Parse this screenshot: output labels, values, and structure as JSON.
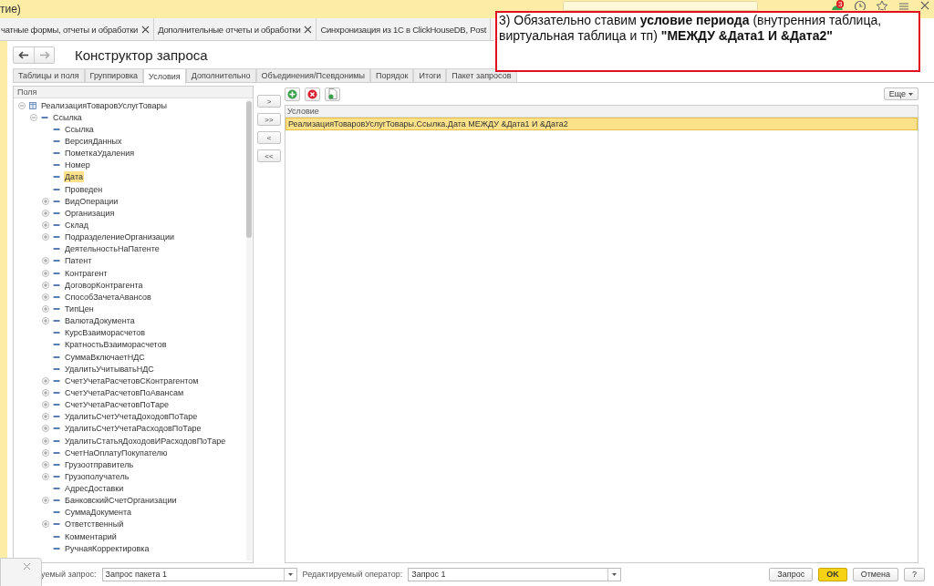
{
  "app_bar": {
    "title": "тие)",
    "badge": "3"
  },
  "window_tabs": [
    {
      "label": "чатные формы, отчеты и обработки",
      "closable": true
    },
    {
      "label": "Дополнительные отчеты и обработки",
      "closable": true
    },
    {
      "label": "Синхронизация из 1С в ClickHouseDB, Post",
      "closable": false
    }
  ],
  "form": {
    "title": "Конструктор запроса",
    "tabs": [
      {
        "label": "Таблицы и поля",
        "selected": false
      },
      {
        "label": "Группировка",
        "selected": false
      },
      {
        "label": "Условия",
        "selected": true
      },
      {
        "label": "Дополнительно",
        "selected": false
      },
      {
        "label": "Объединения/Псевдонимы",
        "selected": false
      },
      {
        "label": "Порядок",
        "selected": false
      },
      {
        "label": "Итоги",
        "selected": false
      },
      {
        "label": "Пакет запросов",
        "selected": false
      }
    ],
    "fields_header": "Поля",
    "tree": [
      {
        "label": "РеализацияТоваровУслугТовары",
        "kind": "table",
        "expanded": true,
        "selected": false,
        "children": [
          {
            "label": "Ссылка",
            "kind": "field",
            "expanded": true,
            "selected": false,
            "children": [
              {
                "label": "Ссылка",
                "kind": "field",
                "expandable": false,
                "selected": false
              },
              {
                "label": "ВерсияДанных",
                "kind": "field",
                "expandable": false,
                "selected": false
              },
              {
                "label": "ПометкаУдаления",
                "kind": "field",
                "expandable": false,
                "selected": false
              },
              {
                "label": "Номер",
                "kind": "field",
                "expandable": false,
                "selected": false
              },
              {
                "label": "Дата",
                "kind": "field",
                "expandable": false,
                "selected": true
              },
              {
                "label": "Проведен",
                "kind": "field",
                "expandable": false,
                "selected": false
              },
              {
                "label": "ВидОперации",
                "kind": "field",
                "expandable": true,
                "selected": false
              },
              {
                "label": "Организация",
                "kind": "field",
                "expandable": true,
                "selected": false
              },
              {
                "label": "Склад",
                "kind": "field",
                "expandable": true,
                "selected": false
              },
              {
                "label": "ПодразделениеОрганизации",
                "kind": "field",
                "expandable": true,
                "selected": false
              },
              {
                "label": "ДеятельностьНаПатенте",
                "kind": "field",
                "expandable": false,
                "selected": false
              },
              {
                "label": "Патент",
                "kind": "field",
                "expandable": true,
                "selected": false
              },
              {
                "label": "Контрагент",
                "kind": "field",
                "expandable": true,
                "selected": false
              },
              {
                "label": "ДоговорКонтрагента",
                "kind": "field",
                "expandable": true,
                "selected": false
              },
              {
                "label": "СпособЗачетаАвансов",
                "kind": "field",
                "expandable": true,
                "selected": false
              },
              {
                "label": "ТипЦен",
                "kind": "field",
                "expandable": true,
                "selected": false
              },
              {
                "label": "ВалютаДокумента",
                "kind": "field",
                "expandable": true,
                "selected": false
              },
              {
                "label": "КурсВзаиморасчетов",
                "kind": "field",
                "expandable": false,
                "selected": false
              },
              {
                "label": "КратностьВзаиморасчетов",
                "kind": "field",
                "expandable": false,
                "selected": false
              },
              {
                "label": "СуммаВключаетНДС",
                "kind": "field",
                "expandable": false,
                "selected": false
              },
              {
                "label": "УдалитьУчитыватьНДС",
                "kind": "field",
                "expandable": false,
                "selected": false
              },
              {
                "label": "СчетУчетаРасчетовСКонтрагентом",
                "kind": "field",
                "expandable": true,
                "selected": false
              },
              {
                "label": "СчетУчетаРасчетовПоАвансам",
                "kind": "field",
                "expandable": true,
                "selected": false
              },
              {
                "label": "СчетУчетаРасчетовПоТаре",
                "kind": "field",
                "expandable": true,
                "selected": false
              },
              {
                "label": "УдалитьСчетУчетаДоходовПоТаре",
                "kind": "field",
                "expandable": true,
                "selected": false
              },
              {
                "label": "УдалитьСчетУчетаРасходовПоТаре",
                "kind": "field",
                "expandable": true,
                "selected": false
              },
              {
                "label": "УдалитьСтатьяДоходовИРасходовПоТаре",
                "kind": "field",
                "expandable": true,
                "selected": false
              },
              {
                "label": "СчетНаОплатуПокупателю",
                "kind": "field",
                "expandable": true,
                "selected": false
              },
              {
                "label": "Грузоотправитель",
                "kind": "field",
                "expandable": true,
                "selected": false
              },
              {
                "label": "Грузополучатель",
                "kind": "field",
                "expandable": true,
                "selected": false
              },
              {
                "label": "АдресДоставки",
                "kind": "field",
                "expandable": false,
                "selected": false
              },
              {
                "label": "БанковскийСчетОрганизации",
                "kind": "field",
                "expandable": true,
                "selected": false
              },
              {
                "label": "СуммаДокумента",
                "kind": "field",
                "expandable": false,
                "selected": false
              },
              {
                "label": "Ответственный",
                "kind": "field",
                "expandable": true,
                "selected": false
              },
              {
                "label": "Комментарий",
                "kind": "field",
                "expandable": false,
                "selected": false
              },
              {
                "label": "РучнаяКорректировка",
                "kind": "field",
                "expandable": false,
                "selected": false
              }
            ]
          }
        ]
      }
    ],
    "move_buttons": [
      ">",
      ">>",
      "<",
      "<<"
    ],
    "more_button": "Еще",
    "conditions": {
      "column": "Условие",
      "rows": [
        {
          "text": "РеализацияТоваровУслугТовары.Ссылка.Дата МЕЖДУ &Дата1 И &Дата2",
          "selected": true
        }
      ]
    },
    "bottom": {
      "query_label": "уемый запрос:",
      "query_value": "Запрос пакета 1",
      "operator_label": "Редактируемый оператор:",
      "operator_value": "Запрос 1",
      "buttons": [
        {
          "label": "Запрос",
          "kind": "normal"
        },
        {
          "label": "OK",
          "kind": "default"
        },
        {
          "label": "Отмена",
          "kind": "normal"
        },
        {
          "label": "?",
          "kind": "normal"
        }
      ]
    }
  },
  "annotation": {
    "text": "3) Обязательно ставим **условие периода** (внутренния таблица, виртуальная таблица и тп) **\"МЕЖДУ &Дата1 И &Дата2\"**"
  }
}
